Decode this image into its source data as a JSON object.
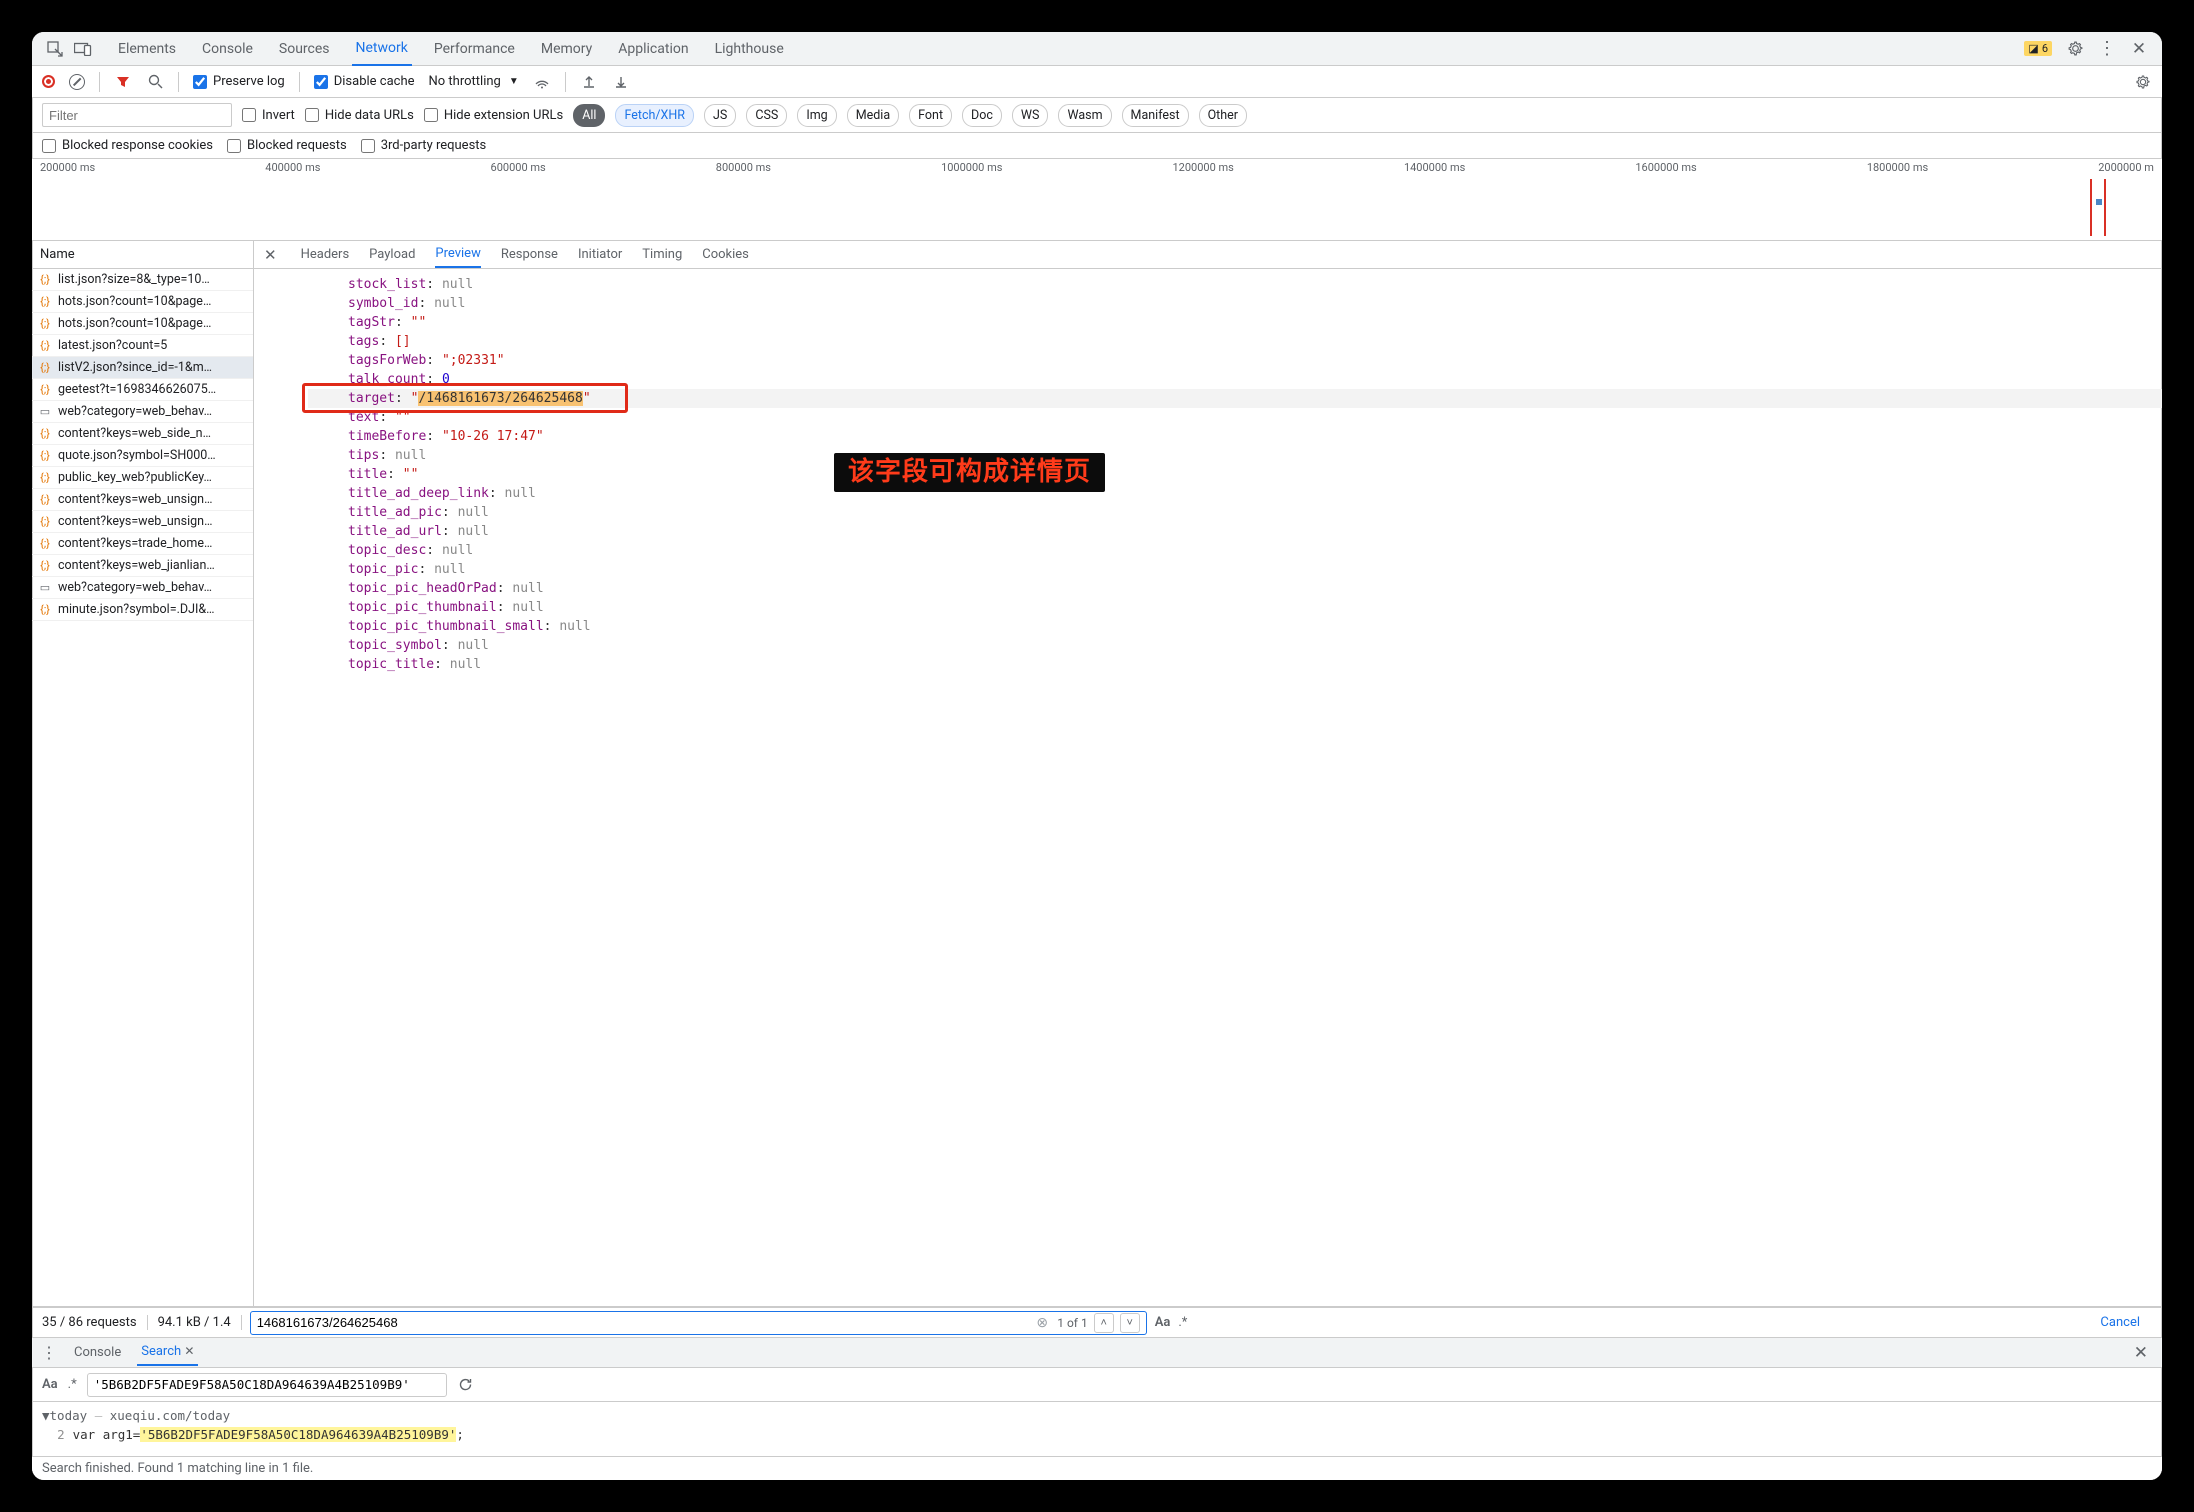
{
  "topTabs": {
    "elements": "Elements",
    "console": "Console",
    "sources": "Sources",
    "network": "Network",
    "performance": "Performance",
    "memory": "Memory",
    "application": "Application",
    "lighthouse": "Lighthouse"
  },
  "warnings_count": "6",
  "toolbar": {
    "preserve_log": "Preserve log",
    "disable_cache": "Disable cache",
    "throttling": "No throttling"
  },
  "filter": {
    "placeholder": "Filter",
    "invert": "Invert",
    "hide_data": "Hide data URLs",
    "hide_ext": "Hide extension URLs"
  },
  "types": {
    "all": "All",
    "fetch": "Fetch/XHR",
    "js": "JS",
    "css": "CSS",
    "img": "Img",
    "media": "Media",
    "font": "Font",
    "doc": "Doc",
    "ws": "WS",
    "wasm": "Wasm",
    "manifest": "Manifest",
    "other": "Other"
  },
  "filter2": {
    "blocked_resp": "Blocked response cookies",
    "blocked_req": "Blocked requests",
    "third_party": "3rd-party requests"
  },
  "timeline_ticks": [
    "200000 ms",
    "400000 ms",
    "600000 ms",
    "800000 ms",
    "1000000 ms",
    "1200000 ms",
    "1400000 ms",
    "1600000 ms",
    "1800000 ms",
    "2000000 m"
  ],
  "req_header": "Name",
  "requests": [
    {
      "icon": "json",
      "name": "list.json?size=8&_type=10…"
    },
    {
      "icon": "json",
      "name": "hots.json?count=10&page…"
    },
    {
      "icon": "json",
      "name": "hots.json?count=10&page…"
    },
    {
      "icon": "json",
      "name": "latest.json?count=5"
    },
    {
      "icon": "json",
      "name": "listV2.json?since_id=-1&m…",
      "selected": true
    },
    {
      "icon": "json",
      "name": "geetest?t=1698346626075…"
    },
    {
      "icon": "doc",
      "name": "web?category=web_behav…"
    },
    {
      "icon": "json",
      "name": "content?keys=web_side_n…"
    },
    {
      "icon": "json",
      "name": "quote.json?symbol=SH000…"
    },
    {
      "icon": "json",
      "name": "public_key_web?publicKey…"
    },
    {
      "icon": "json",
      "name": "content?keys=web_unsign…"
    },
    {
      "icon": "json",
      "name": "content?keys=web_unsign…"
    },
    {
      "icon": "json",
      "name": "content?keys=trade_home…"
    },
    {
      "icon": "json",
      "name": "content?keys=web_jianlian…"
    },
    {
      "icon": "doc",
      "name": "web?category=web_behav…"
    },
    {
      "icon": "json",
      "name": "minute.json?symbol=.DJI&…"
    }
  ],
  "detail_tabs": {
    "headers": "Headers",
    "payload": "Payload",
    "preview": "Preview",
    "response": "Response",
    "initiator": "Initiator",
    "timing": "Timing",
    "cookies": "Cookies"
  },
  "preview_rows": [
    {
      "k": "stock_list",
      "v": "null",
      "t": "null"
    },
    {
      "k": "symbol_id",
      "v": "null",
      "t": "null"
    },
    {
      "k": "tagStr",
      "v": "\"\"",
      "t": "str"
    },
    {
      "k": "tags",
      "v": "[]",
      "t": "str"
    },
    {
      "k": "tagsForWeb",
      "v": "\";02331\"",
      "t": "str"
    },
    {
      "k": "talk_count",
      "v": "0",
      "t": "num"
    },
    {
      "k": "target",
      "v_pre": "\"",
      "v_mark": "/1468161673/264625468",
      "v_post": "\"",
      "t": "target"
    },
    {
      "k": "text",
      "v": "\"\"",
      "t": "str"
    },
    {
      "k": "timeBefore",
      "v": "\"10-26 17:47\"",
      "t": "str"
    },
    {
      "k": "tips",
      "v": "null",
      "t": "null"
    },
    {
      "k": "title",
      "v": "\"\"",
      "t": "str"
    },
    {
      "k": "title_ad_deep_link",
      "v": "null",
      "t": "null"
    },
    {
      "k": "title_ad_pic",
      "v": "null",
      "t": "null"
    },
    {
      "k": "title_ad_url",
      "v": "null",
      "t": "null"
    },
    {
      "k": "topic_desc",
      "v": "null",
      "t": "null"
    },
    {
      "k": "topic_pic",
      "v": "null",
      "t": "null"
    },
    {
      "k": "topic_pic_headOrPad",
      "v": "null",
      "t": "null"
    },
    {
      "k": "topic_pic_thumbnail",
      "v": "null",
      "t": "null"
    },
    {
      "k": "topic_pic_thumbnail_small",
      "v": "null",
      "t": "null"
    },
    {
      "k": "topic_symbol",
      "v": "null",
      "t": "null"
    },
    {
      "k": "topic_title",
      "v": "null",
      "t": "null"
    }
  ],
  "callout": "该字段可构成详情页",
  "status": {
    "requests": "35 / 86 requests",
    "transfer": "94.1 kB / 1.4"
  },
  "find": {
    "value": "1468161673/264625468",
    "result": "1 of 1",
    "cancel": "Cancel"
  },
  "drawer": {
    "tabs": {
      "console": "Console",
      "search": "Search"
    },
    "search_value": "'5B6B2DF5FADE9F58A50C18DA964639A4B25109B9'",
    "hdr_name": "today",
    "hdr_path": "xueqiu.com/today",
    "line_no": "2",
    "line_pre": "var arg1=",
    "line_hl": "'5B6B2DF5FADE9F58A50C18DA964639A4B25109B9'",
    "line_post": ";"
  },
  "footer": "Search finished. Found 1 matching line in 1 file."
}
